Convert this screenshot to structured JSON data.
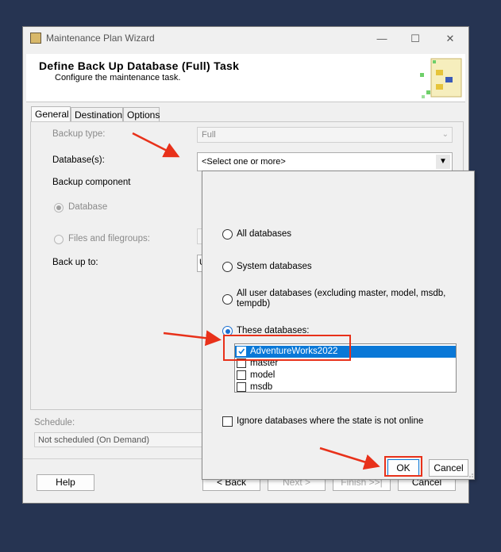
{
  "window": {
    "title": "Maintenance Plan Wizard",
    "header_title": "Define Back Up Database (Full) Task",
    "header_subtitle": "Configure the maintenance task.",
    "controls": {
      "minimize": "—",
      "maximize": "☐",
      "close": "✕"
    }
  },
  "tabs": [
    "General",
    "Destination",
    "Options"
  ],
  "general": {
    "backup_type_label": "Backup type:",
    "backup_type_value": "Full",
    "databases_label": "Database(s):",
    "databases_value": "<Select one or more>",
    "backup_component_label": "Backup component",
    "component_database": "Database",
    "component_files": "Files and filegroups:",
    "back_up_to_label": "Back up to:",
    "back_up_to_value_partial": "U"
  },
  "schedule": {
    "label": "Schedule:",
    "value": "Not scheduled (On Demand)"
  },
  "footer": {
    "help": "Help",
    "back": "< Back",
    "next": "Next >",
    "finish": "Finish >>|",
    "cancel": "Cancel"
  },
  "popup": {
    "options": [
      {
        "label": "All databases",
        "selected": false
      },
      {
        "label": "System databases",
        "selected": false
      },
      {
        "label": "All user databases  (excluding master, model, msdb,",
        "label2": "tempdb)",
        "selected": false
      },
      {
        "label": "These databases:",
        "selected": true
      }
    ],
    "databases": [
      {
        "name": "AdventureWorks2022",
        "checked": true,
        "highlighted": true
      },
      {
        "name": "master",
        "checked": false
      },
      {
        "name": "model",
        "checked": false
      },
      {
        "name": "msdb",
        "checked": false
      }
    ],
    "ignore_offline_label": "Ignore databases where the state is not online",
    "ok": "OK",
    "cancel": "Cancel"
  },
  "colors": {
    "background": "#263452",
    "annotation_red": "#e8311a",
    "selection_blue": "#0a78d7"
  }
}
